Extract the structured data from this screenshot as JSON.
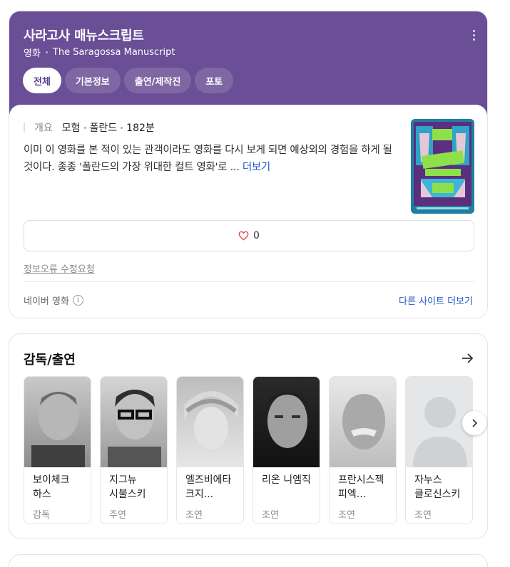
{
  "header": {
    "title": "사라고사 매뉴스크립트",
    "category": "영화",
    "original_title": "The Saragossa Manuscript",
    "tabs": [
      {
        "label": "전체",
        "active": true
      },
      {
        "label": "기본정보",
        "active": false
      },
      {
        "label": "출연/제작진",
        "active": false
      },
      {
        "label": "포토",
        "active": false
      }
    ]
  },
  "overview": {
    "label": "개요",
    "genre": "모험",
    "country": "폴란드",
    "runtime": "182분",
    "description": "이미 이 영화를 본 적이 있는 관객이라도 영화를 다시 보게 되면 예상외의 경험을 하게 될 것이다. 종종 '폴란드의 가장 위대한 컬트 영화'로 ...",
    "more_label": "더보기",
    "poster_icon": "movie-poster"
  },
  "like": {
    "count": "0",
    "icon": "heart-icon"
  },
  "report_label": "정보오류 수정요청",
  "source": {
    "label": "네이버 영화",
    "other_sites_label": "다른 사이트 더보기"
  },
  "cast": {
    "title": "감독/출연",
    "people": [
      {
        "name": "보이체크 하스",
        "role": "감독"
      },
      {
        "name": "지그뉴 시불스키",
        "role": "주연"
      },
      {
        "name": "엘즈비에타 크지...",
        "role": "조연"
      },
      {
        "name": "리온 니엠직",
        "role": "조연"
      },
      {
        "name": "프란시스젝 피엑...",
        "role": "조연"
      },
      {
        "name": "자누스 클로신스키",
        "role": "조연"
      }
    ]
  },
  "colors": {
    "header_bg": "#6a4f96",
    "link": "#1f57c6",
    "active_tab_text": "#5a3f8a"
  }
}
